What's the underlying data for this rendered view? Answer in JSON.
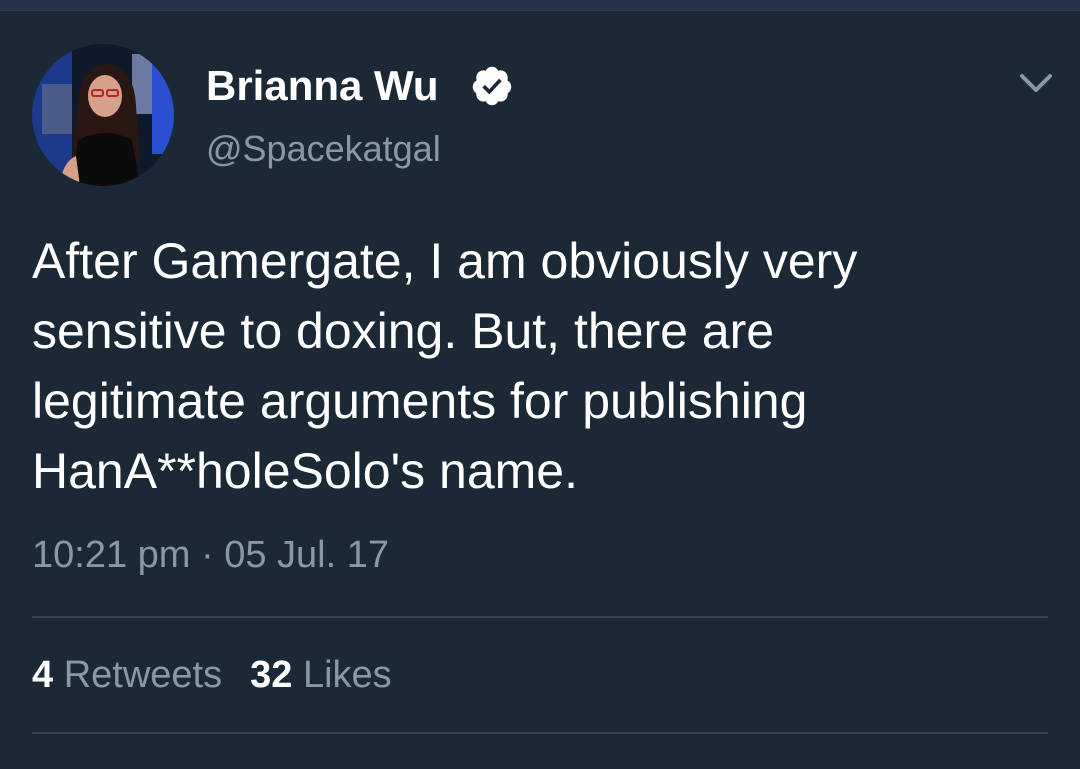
{
  "tweet": {
    "author": {
      "display_name": "Brianna Wu",
      "handle": "@Spacekatgal",
      "verified": true
    },
    "text_lines": [
      "After Gamergate, I am obviously very",
      "sensitive to doxing. But, there are",
      "legitimate arguments for publishing",
      "HanA**holeSolo's name."
    ],
    "timestamp": "10:21 pm · 05 Jul. 17",
    "stats": {
      "retweets_count": "4",
      "retweets_label": "Retweets",
      "likes_count": "32",
      "likes_label": "Likes"
    }
  },
  "icons": {
    "verified": "verified-badge-icon",
    "menu": "chevron-down-icon"
  },
  "colors": {
    "background": "#1b2836",
    "text_primary": "#ffffff",
    "text_secondary": "#8899a6",
    "divider": "#38444d"
  }
}
